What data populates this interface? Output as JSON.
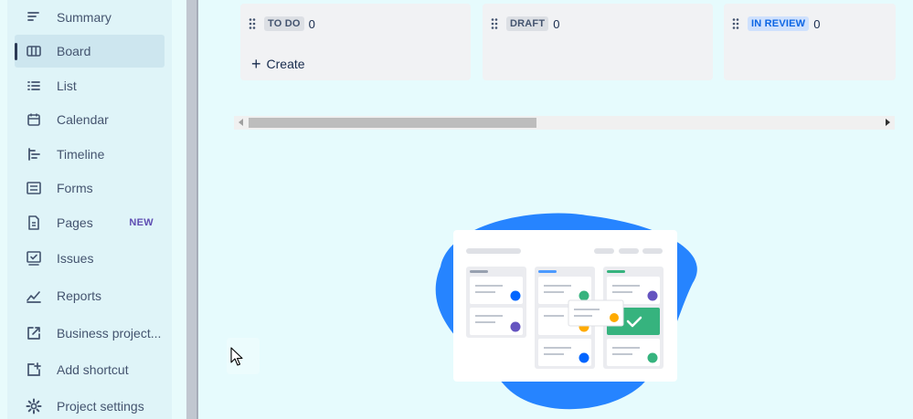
{
  "sidebar": {
    "items": [
      {
        "label": "Summary",
        "icon": "summary-icon"
      },
      {
        "label": "Board",
        "icon": "board-icon",
        "active": true
      },
      {
        "label": "List",
        "icon": "list-icon"
      },
      {
        "label": "Calendar",
        "icon": "calendar-icon"
      },
      {
        "label": "Timeline",
        "icon": "timeline-icon"
      },
      {
        "label": "Forms",
        "icon": "forms-icon"
      },
      {
        "label": "Pages",
        "icon": "pages-icon",
        "badge": "NEW"
      },
      {
        "label": "Issues",
        "icon": "issues-icon"
      },
      {
        "label": "Reports",
        "icon": "reports-icon"
      },
      {
        "label": "Business project...",
        "icon": "external-link-icon"
      },
      {
        "label": "Add shortcut",
        "icon": "add-shortcut-icon"
      },
      {
        "label": "Project settings",
        "icon": "gear-icon"
      }
    ]
  },
  "board": {
    "columns": [
      {
        "title": "TO DO",
        "count": "0",
        "create_label": "Create"
      },
      {
        "title": "DRAFT",
        "count": "0"
      },
      {
        "title": "IN REVIEW",
        "count": "0"
      }
    ]
  },
  "colors": {
    "background": "#e6fbfd",
    "sidebar": "#dff4f8",
    "active_item": "#cde6ef",
    "blob": "#2684ff",
    "green": "#36b37e",
    "purple": "#6554c0",
    "blue": "#0065ff",
    "orange": "#ffab00",
    "new_badge": "#5e4db2",
    "in_review": "#0c66e4"
  }
}
